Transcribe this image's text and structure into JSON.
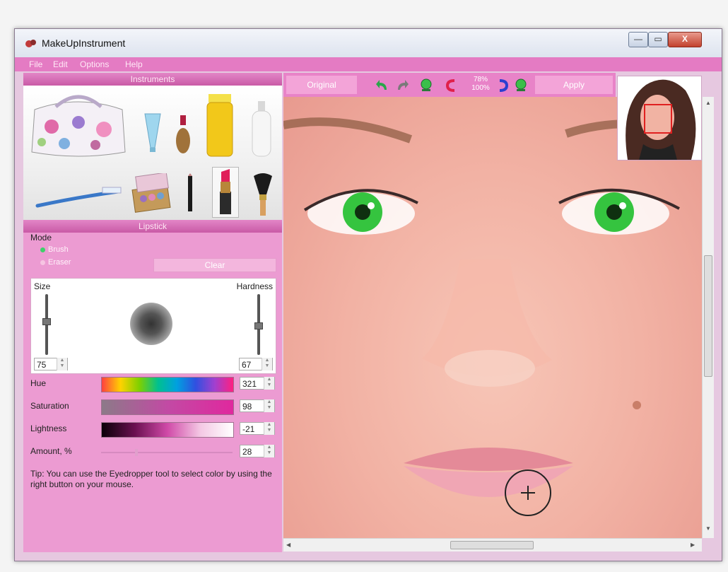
{
  "window": {
    "title": "MakeUpInstrument",
    "buttons": {
      "minimize": "—",
      "maximize": "▭",
      "close": "X"
    }
  },
  "menu": [
    "File",
    "Edit",
    "Options",
    "Help"
  ],
  "instruments": {
    "header": "Instruments",
    "tools": [
      "makeup-bag",
      "concealer-tube",
      "foundation-bottle",
      "powder-tube",
      "lotion-bottle",
      "toothbrush",
      "eyeshadow-palette",
      "eyeliner",
      "lipstick",
      "blush-brush"
    ],
    "selected": "lipstick"
  },
  "lipstick": {
    "header": "Lipstick",
    "mode_label": "Mode",
    "modes": [
      "Brush",
      "Eraser"
    ],
    "selected_mode": "Brush",
    "clear_label": "Clear",
    "size_label": "Size",
    "size_value": "75",
    "hardness_label": "Hardness",
    "hardness_value": "67",
    "hue_label": "Hue",
    "hue_value": "321",
    "saturation_label": "Saturation",
    "saturation_value": "98",
    "lightness_label": "Lightness",
    "lightness_value": "-21",
    "amount_label": "Amount, %",
    "amount_value": "28",
    "tip": "Tip: You can use the Eyedropper tool to select color by using the right button on your mouse."
  },
  "toolbar": {
    "original_label": "Original",
    "apply_label": "Apply",
    "zoom_percent": "78%",
    "zoom_ratio": "100%"
  },
  "colors": {
    "accent": "#e47bc3",
    "panel": "#ec9bd2",
    "eye": "#35c43f"
  }
}
